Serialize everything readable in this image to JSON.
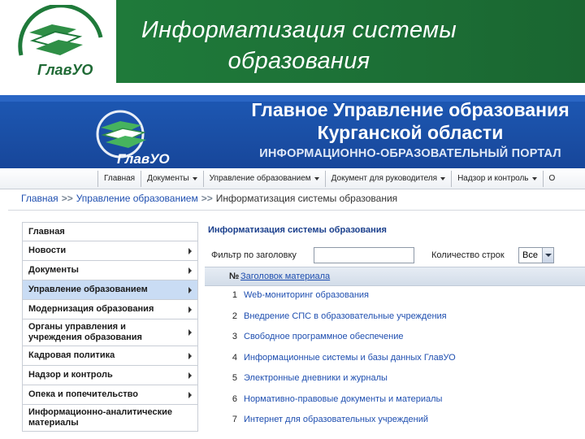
{
  "slide": {
    "title_line1": "Информатизация системы",
    "title_line2": "образования",
    "logo_text": "ГлавУО"
  },
  "portal": {
    "title_line1": "Главное Управление образования",
    "title_line2": "Курганской области",
    "subtitle": "ИНФОРМАЦИОННО-ОБРАЗОВАТЕЛЬНЫЙ ПОРТАЛ",
    "logo_text": "ГлавУО"
  },
  "top_menu": [
    {
      "label": "Главная",
      "dropdown": false
    },
    {
      "label": "Документы",
      "dropdown": true
    },
    {
      "label": "Управление образованием",
      "dropdown": true
    },
    {
      "label": "Документ для руководителя",
      "dropdown": true
    },
    {
      "label": "Надзор и контроль",
      "dropdown": true
    },
    {
      "label": "О",
      "dropdown": false
    }
  ],
  "breadcrumb": {
    "items": [
      "Главная",
      "Управление образованием",
      "Информатизация системы образования"
    ],
    "separator": ">>"
  },
  "sidebar": {
    "items": [
      {
        "label": "Главная",
        "arrow": false,
        "active": false,
        "lines": 1
      },
      {
        "label": "Новости",
        "arrow": true,
        "active": false,
        "lines": 1
      },
      {
        "label": "Документы",
        "arrow": true,
        "active": false,
        "lines": 1
      },
      {
        "label": "Управление образованием",
        "arrow": true,
        "active": true,
        "lines": 1
      },
      {
        "label": "Модернизация образования",
        "arrow": true,
        "active": false,
        "lines": 1
      },
      {
        "label": "Органы управления и учреждения образования",
        "arrow": true,
        "active": false,
        "lines": 2
      },
      {
        "label": "Кадровая политика",
        "arrow": true,
        "active": false,
        "lines": 1
      },
      {
        "label": "Надзор и контроль",
        "arrow": true,
        "active": false,
        "lines": 1
      },
      {
        "label": "Опека и попечительство",
        "arrow": true,
        "active": false,
        "lines": 1
      },
      {
        "label": "Информационно-аналитические материалы",
        "arrow": false,
        "active": false,
        "lines": 2
      }
    ]
  },
  "main": {
    "title": "Информатизация системы образования",
    "filter_label": "Фильтр по заголовку",
    "filter_value": "",
    "count_label": "Количество строк",
    "count_value": "Все",
    "table": {
      "col_num": "№",
      "col_title": "Заголовок материала",
      "rows": [
        {
          "num": "1",
          "title": "Web-мониторинг образования"
        },
        {
          "num": "2",
          "title": "Внедрение СПС в образовательные учреждения"
        },
        {
          "num": "3",
          "title": "Свободное программное обеспечение"
        },
        {
          "num": "4",
          "title": "Информационные системы и базы данных ГлавУО"
        },
        {
          "num": "5",
          "title": "Электронные дневники и журналы"
        },
        {
          "num": "6",
          "title": "Нормативно-правовые документы и материалы"
        },
        {
          "num": "7",
          "title": "Интернет для образовательных учреждений"
        }
      ]
    }
  },
  "colors": {
    "slide_banner": "#1d7237",
    "portal_header": "#1a4ea4",
    "link": "#1f4fb0",
    "active_item": "#c9dcf4"
  }
}
